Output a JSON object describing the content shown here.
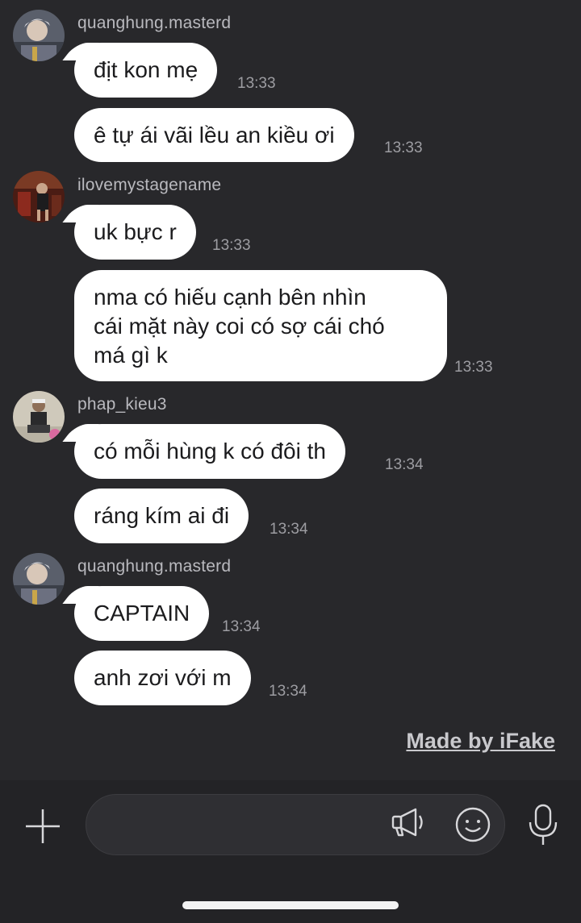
{
  "groups": [
    {
      "sender": "quanghung.masterd",
      "messages": [
        {
          "text": "địt kon mẹ",
          "time": "13:33"
        },
        {
          "text": "ê tự ái vãi lều an kiều ơi",
          "time": "13:33"
        }
      ]
    },
    {
      "sender": "ilovemystagename",
      "messages": [
        {
          "text": "uk bực r",
          "time": "13:33"
        },
        {
          "lines": [
            "nma có hiếu cạnh bên nhìn",
            "cái mặt này coi có sợ cái chó",
            "má gì k"
          ],
          "time": "13:33"
        }
      ]
    },
    {
      "sender": "phap_kieu3",
      "messages": [
        {
          "text": "có mỗi hùng k có đôi th",
          "time": "13:34"
        },
        {
          "text": "ráng kím ai đi",
          "time": "13:34"
        }
      ]
    },
    {
      "sender": "quanghung.masterd",
      "messages": [
        {
          "text": "CAPTAIN",
          "time": "13:34"
        },
        {
          "text": "anh zơi với m",
          "time": "13:34"
        }
      ]
    }
  ],
  "watermark": "Made by iFake",
  "composer": {
    "value": "",
    "icons": [
      "plus-icon",
      "megaphone-icon",
      "emoji-icon",
      "microphone-icon"
    ]
  },
  "colors": {
    "background": "#28282b",
    "bubble": "#ffffff",
    "bottom_bar": "#232326"
  }
}
